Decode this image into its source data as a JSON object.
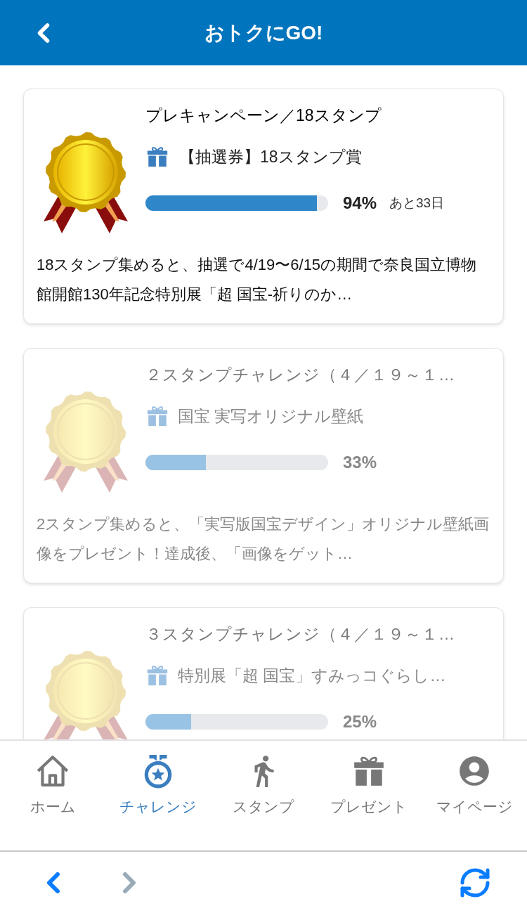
{
  "header": {
    "title": "おトクにGO!"
  },
  "challenges": [
    {
      "title": "プレキャンペーン／18スタンプ",
      "active": true,
      "prize": "【抽選券】18スタンプ賞",
      "level": 0.94,
      "percent": "94%",
      "remaining": "あと33日",
      "description": "18スタンプ集めると、抽選で4/19〜6/15の期間で奈良国立博物館開館130年記念特別展「超 国宝-祈りのか…"
    },
    {
      "title": "２スタンプチャレンジ（４／１９～１…",
      "active": false,
      "prize": "国宝 実写オリジナル壁紙",
      "level": 0.33,
      "percent": "33%",
      "description": "2スタンプ集めると、「実写版国宝デザイン」オリジナル壁紙画像をプレゼント！達成後、「画像をゲット…"
    },
    {
      "title": "３スタンプチャレンジ（４／１９～１…",
      "active": false,
      "prize": "特別展「超 国宝」すみっコぐらし…",
      "level": 0.25,
      "percent": "25%"
    }
  ],
  "tab_bar": [
    {
      "label": "ホーム",
      "kind": "home",
      "selected": false
    },
    {
      "label": "チャレンジ",
      "kind": "medal",
      "selected": true
    },
    {
      "label": "スタンプ",
      "kind": "walk",
      "selected": false
    },
    {
      "label": "プレゼント",
      "kind": "gift",
      "selected": false
    },
    {
      "label": "マイページ",
      "kind": "user",
      "selected": false
    }
  ],
  "browser_bar": {
    "back_enabled": true,
    "forward_enabled": false
  }
}
